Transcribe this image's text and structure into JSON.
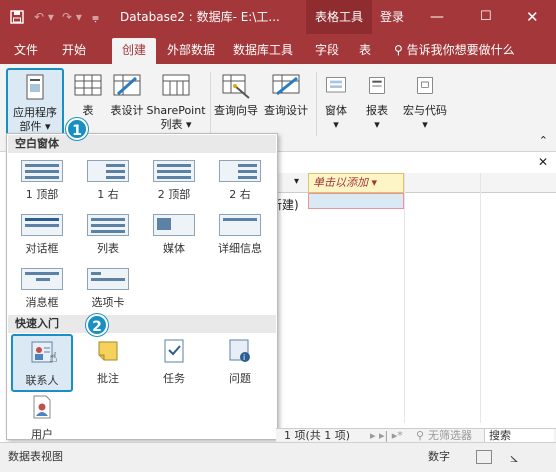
{
  "window": {
    "title": "Database2 : 数据库- E:\\工...",
    "context_tab": "表格工具",
    "login": "登录",
    "colors": {
      "accent": "#a4373a",
      "highlight": "#1a8fc4"
    }
  },
  "tabs": [
    {
      "label": "文件"
    },
    {
      "label": "开始"
    },
    {
      "label": "创建",
      "active": true
    },
    {
      "label": "外部数据"
    },
    {
      "label": "数据库工具"
    },
    {
      "label": "字段"
    },
    {
      "label": "表"
    }
  ],
  "tell_me": "告诉我你想要做什么",
  "ribbon": {
    "app_parts": "应用程序\n部件 ▾",
    "table": "表",
    "table_design": "表设计",
    "sharepoint": "SharePoint\n列表 ▾",
    "query_wizard": "查询向导",
    "query_design": "查询设计",
    "form": "窗体",
    "report": "报表",
    "macros": "宏与代码"
  },
  "dropdown": {
    "blank_forms_header": "空白窗体",
    "blank_forms": [
      {
        "label": "1 顶部"
      },
      {
        "label": "1 右"
      },
      {
        "label": "2 顶部"
      },
      {
        "label": "2 右"
      },
      {
        "label": "对话框"
      },
      {
        "label": "列表"
      },
      {
        "label": "媒体"
      },
      {
        "label": "详细信息"
      },
      {
        "label": "消息框"
      },
      {
        "label": "选项卡"
      }
    ],
    "quick_start_header": "快速入门",
    "quick_start": [
      {
        "label": "联系人",
        "icon": "contacts-icon"
      },
      {
        "label": "批注",
        "icon": "comments-icon"
      },
      {
        "label": "任务",
        "icon": "tasks-icon"
      },
      {
        "label": "问题",
        "icon": "issues-icon"
      },
      {
        "label": "用户",
        "icon": "users-icon"
      }
    ]
  },
  "table": {
    "new_col_header": "单击以添加",
    "cell_text": "新建)"
  },
  "callouts": {
    "one": "1",
    "two": "2"
  },
  "record_nav": {
    "record_text": "1 项(共 1 项)",
    "filter": "无筛选器",
    "search": "搜索"
  },
  "status": {
    "view": "数据表视图",
    "numlock": "数字"
  }
}
